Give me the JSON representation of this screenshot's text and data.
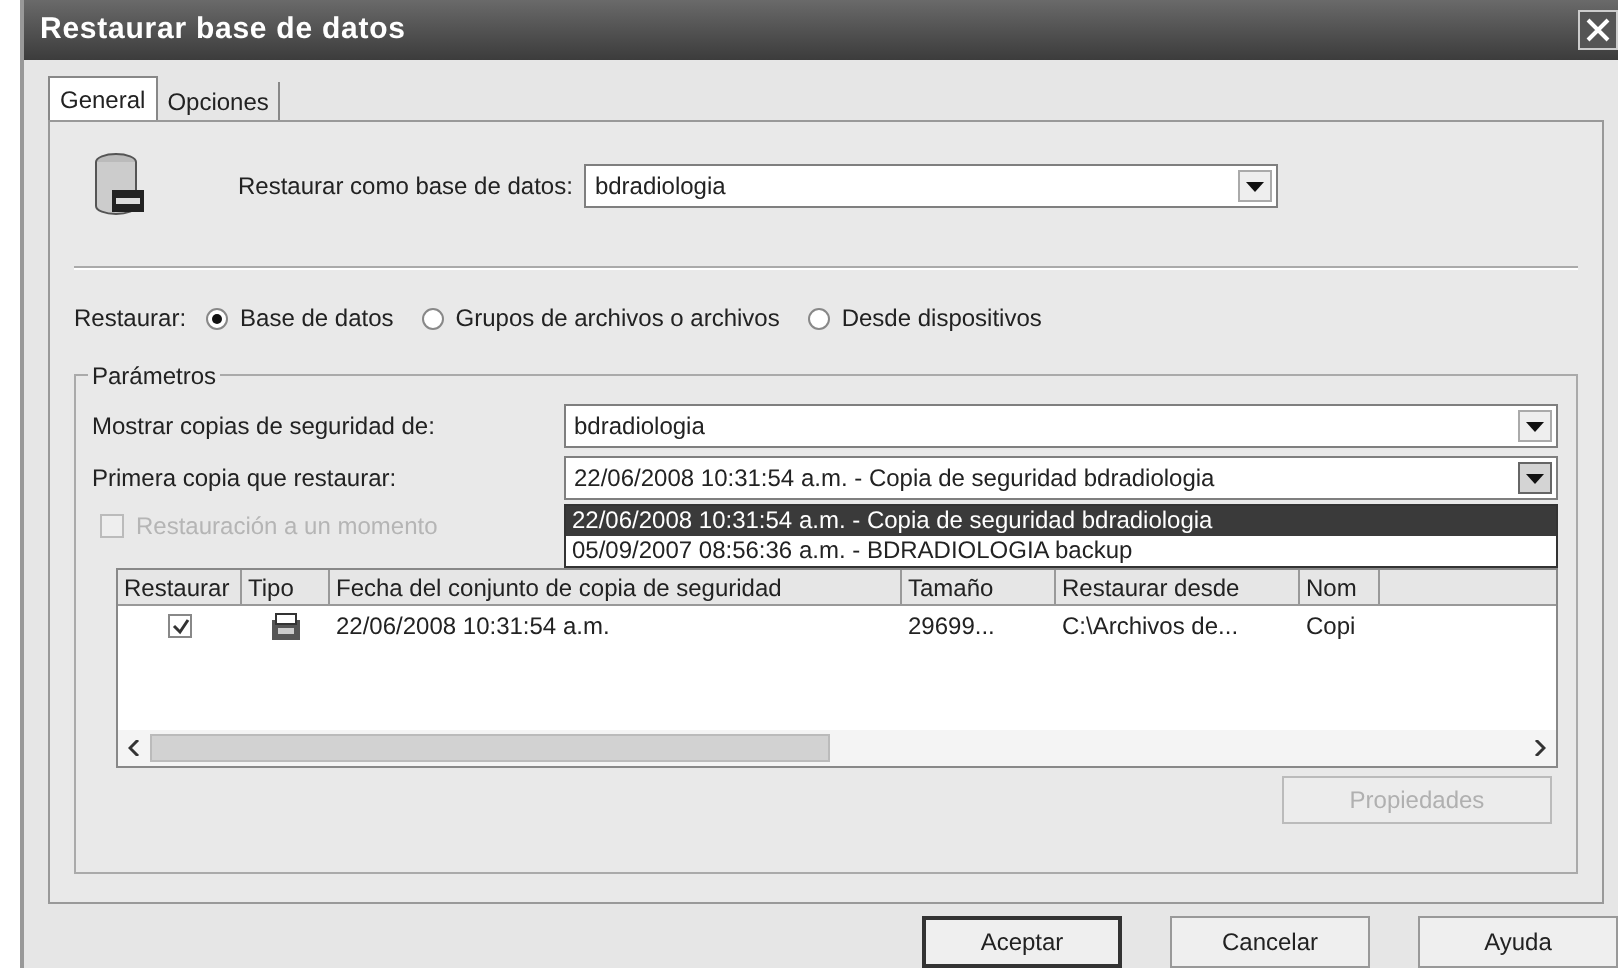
{
  "window": {
    "title": "Restaurar base de datos"
  },
  "tabs": [
    {
      "label": "General",
      "selected": true
    },
    {
      "label": "Opciones",
      "selected": false
    }
  ],
  "restore_as": {
    "label": "Restaurar como base de datos:",
    "value": "bdradiologia"
  },
  "restore_type": {
    "label": "Restaurar:",
    "options": [
      {
        "label": "Base de datos",
        "selected": true
      },
      {
        "label": "Grupos de archivos o archivos",
        "selected": false
      },
      {
        "label": "Desde dispositivos",
        "selected": false
      }
    ]
  },
  "parameters": {
    "title": "Parámetros",
    "show_backups_from": {
      "label": "Mostrar copias de seguridad de:",
      "value": "bdradiologia"
    },
    "first_backup": {
      "label": "Primera copia que restaurar:",
      "value": "22/06/2008 10:31:54 a.m. - Copia de seguridad bdradiologia",
      "expanded": true,
      "options": [
        {
          "label": "22/06/2008 10:31:54 a.m. - Copia de seguridad bdradiologia",
          "selected": true
        },
        {
          "label": "05/09/2007 08:56:36 a.m. - BDRADIOLOGIA backup",
          "selected": false
        }
      ]
    },
    "point_in_time": {
      "label": "Restauración a un momento",
      "checked": false,
      "disabled": true
    },
    "table": {
      "columns": [
        "Restaurar",
        "Tipo",
        "Fecha del conjunto de copia de seguridad",
        "Tamaño",
        "Restaurar desde",
        "Nom"
      ],
      "rows": [
        {
          "checked": true,
          "date": "22/06/2008 10:31:54 a.m.",
          "size": "29699...",
          "source": "C:\\Archivos de...",
          "column_6": "Copi"
        }
      ]
    },
    "properties_button": {
      "label": "Propiedades",
      "disabled": true
    }
  },
  "buttons": [
    {
      "label": "Aceptar",
      "default": true
    },
    {
      "label": "Cancelar",
      "default": false
    },
    {
      "label": "Ayuda",
      "default": false
    }
  ]
}
